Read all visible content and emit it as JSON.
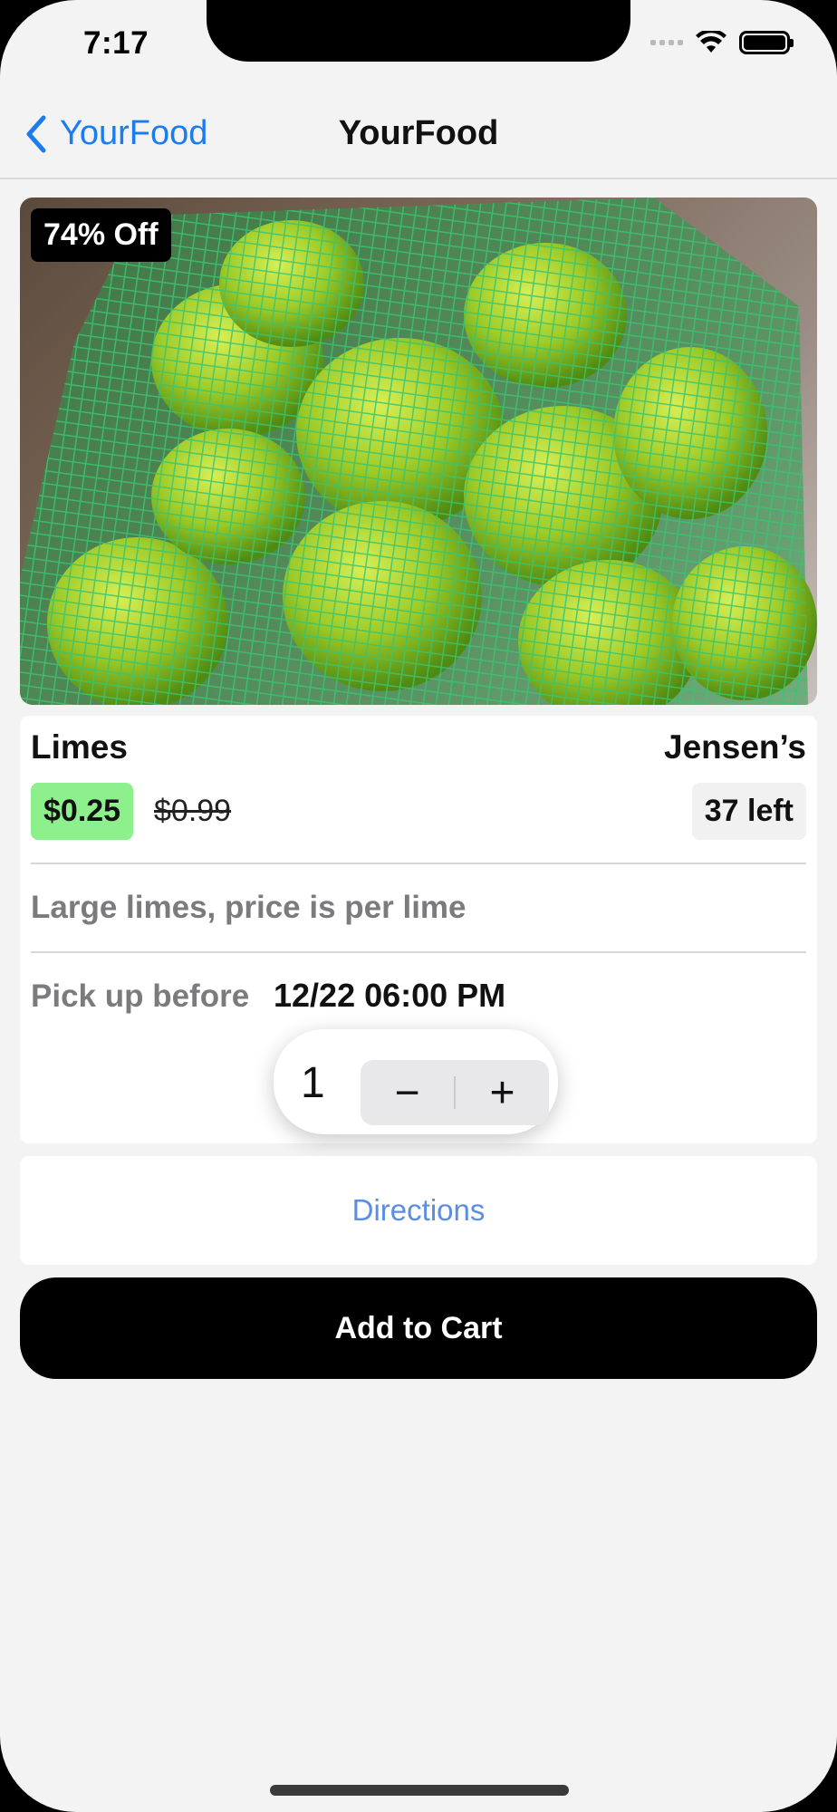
{
  "status_bar": {
    "time": "7:17"
  },
  "nav": {
    "back_label": "YourFood",
    "title": "YourFood"
  },
  "product": {
    "discount": "74% Off",
    "name": "Limes",
    "store": "Jensen’s",
    "sale_price": "$0.25",
    "original_price": "$0.99",
    "stock": "37 left",
    "description": "Large limes, price is per lime",
    "pickup_label": "Pick up before",
    "pickup_time": "12/22 06:00 PM"
  },
  "stepper": {
    "value": "1",
    "minus": "−",
    "plus": "+"
  },
  "directions_label": "Directions",
  "cart_label": "Add to Cart",
  "colors": {
    "accent": "#1a7cf0",
    "sale_price_bg": "#8ef08c",
    "net_green": "#2dbd6a",
    "lime": "#a8d82a"
  },
  "icons": {
    "back": "chevron-left-icon",
    "wifi": "wifi-icon",
    "battery": "battery-icon",
    "signal": "cellular-signal-icon"
  }
}
